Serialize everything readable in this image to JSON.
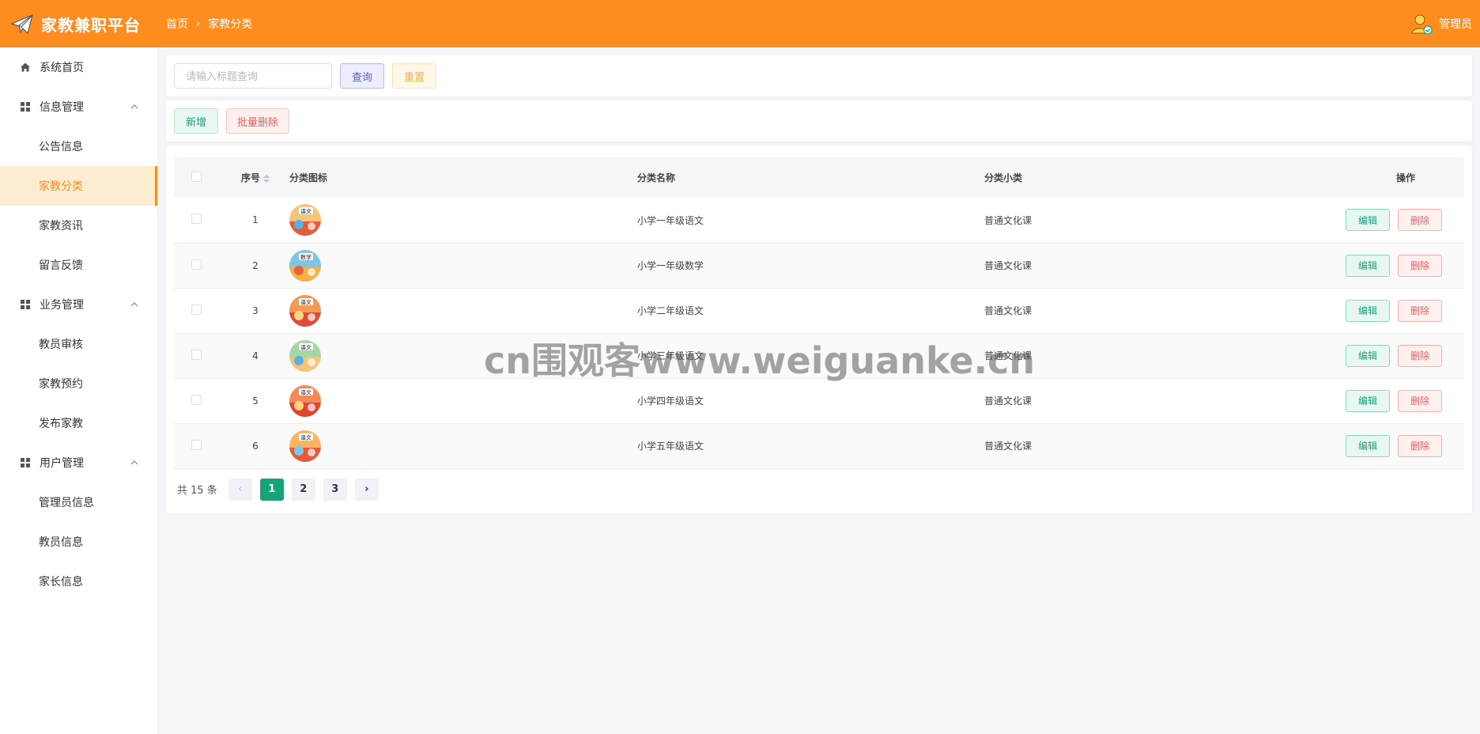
{
  "app": {
    "title": "家教兼职平台"
  },
  "breadcrumb": {
    "home": "首页",
    "current": "家教分类"
  },
  "user": {
    "name": "管理员"
  },
  "sidebar": {
    "home": "系统首页",
    "groups": [
      {
        "label": "信息管理",
        "items": [
          "公告信息",
          "家教分类",
          "家教资讯",
          "留言反馈"
        ]
      },
      {
        "label": "业务管理",
        "items": [
          "教员审核",
          "家教预约",
          "发布家教"
        ]
      },
      {
        "label": "用户管理",
        "items": [
          "管理员信息",
          "教员信息",
          "家长信息"
        ]
      }
    ],
    "active": "家教分类"
  },
  "search": {
    "placeholder": "请输入标题查询",
    "query_label": "查询",
    "reset_label": "重置"
  },
  "actions": {
    "add_label": "新增",
    "batch_delete_label": "批量删除"
  },
  "table": {
    "columns": {
      "index": "序号",
      "icon": "分类图标",
      "name": "分类名称",
      "sub": "分类小类",
      "ops": "操作"
    },
    "rows": [
      {
        "index": "1",
        "name": "小学一年级语文",
        "sub": "普通文化课",
        "thumb": "语文"
      },
      {
        "index": "2",
        "name": "小学一年级数学",
        "sub": "普通文化课",
        "thumb": "数学"
      },
      {
        "index": "3",
        "name": "小学二年级语文",
        "sub": "普通文化课",
        "thumb": "语文"
      },
      {
        "index": "4",
        "name": "小学三年级语文",
        "sub": "普通文化课",
        "thumb": "语文"
      },
      {
        "index": "5",
        "name": "小学四年级语文",
        "sub": "普通文化课",
        "thumb": "语文"
      },
      {
        "index": "6",
        "name": "小学五年级语文",
        "sub": "普通文化课",
        "thumb": "语文"
      }
    ],
    "edit_label": "编辑",
    "delete_label": "删除"
  },
  "pagination": {
    "total_text": "共 15 条",
    "pages": [
      "1",
      "2",
      "3"
    ],
    "current": "1"
  },
  "watermark": "cn围观客www.weiguanke.cn",
  "colors": {
    "primary": "#ff8c1f",
    "success": "#16a37a",
    "danger": "#f15c5c",
    "query": "#5a5fd6"
  }
}
